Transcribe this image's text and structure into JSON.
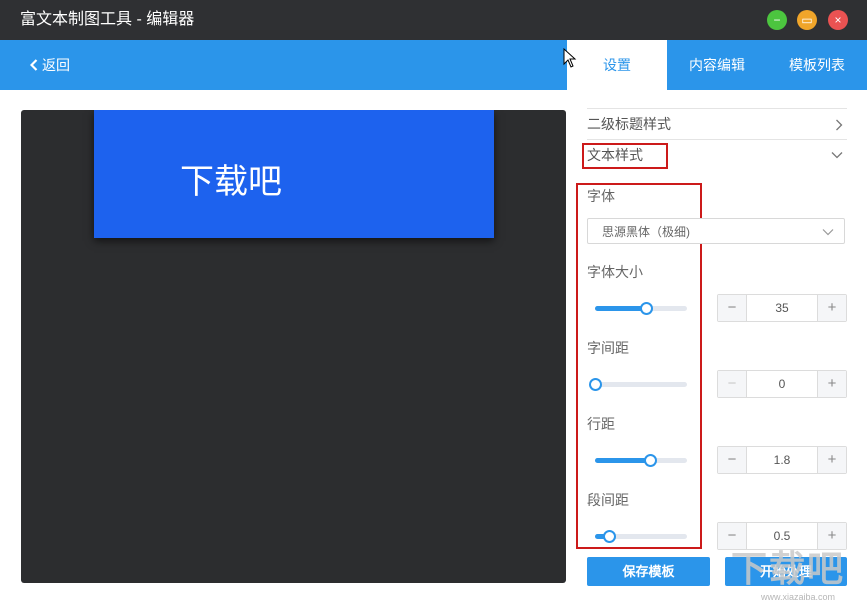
{
  "window": {
    "title": "富文本制图工具 - 编辑器",
    "controls": {
      "minimize": "−",
      "maximize": "▭",
      "close": "×"
    },
    "colors": {
      "minimize": "#4cc53f",
      "maximize": "#f0a52a",
      "close": "#ea5252"
    }
  },
  "toolbar": {
    "back_label": "返回",
    "tabs": [
      {
        "label": "设置",
        "active": true
      },
      {
        "label": "内容编辑",
        "active": false
      },
      {
        "label": "模板列表",
        "active": false
      }
    ],
    "accent": "#2b95ea"
  },
  "canvas": {
    "preview_text": "下载吧",
    "block_color": "#1d62ee"
  },
  "panel": {
    "sections": [
      {
        "label": "二级标题样式",
        "icon": "chevron-right-icon"
      },
      {
        "label": "文本样式",
        "icon": "chevron-down-icon"
      }
    ],
    "font": {
      "label": "字体",
      "value": "思源黑体（极细)"
    },
    "controls": [
      {
        "label": "字体大小",
        "value": "35",
        "slider_fraction": 0.55
      },
      {
        "label": "字间距",
        "value": "0",
        "slider_fraction": 0.0
      },
      {
        "label": "行距",
        "value": "1.8",
        "slider_fraction": 0.6
      },
      {
        "label": "段间距",
        "value": "0.5",
        "slider_fraction": 0.15
      }
    ],
    "buttons": {
      "save": "保存模板",
      "start": "开始处理"
    }
  },
  "watermark": {
    "text": "下载吧",
    "url": "www.xiazaiba.com"
  }
}
